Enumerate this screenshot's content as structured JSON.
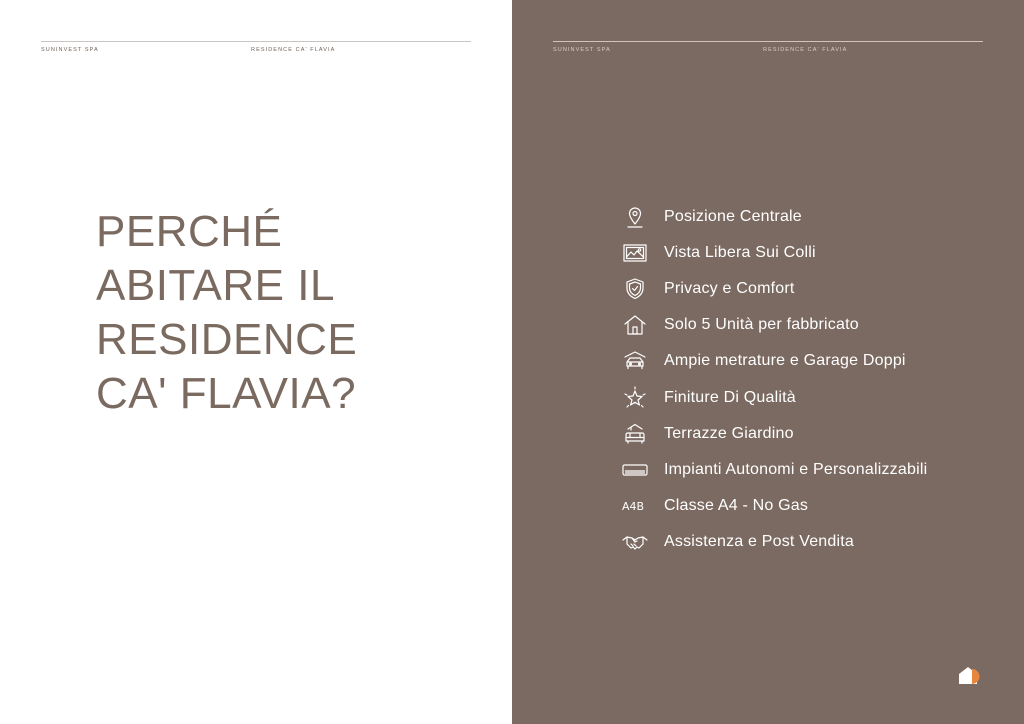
{
  "left_page": {
    "header_company": "SUNINVEST SPA",
    "header_project": "RESIDENCE CA' FLAVIA",
    "headline": [
      "PERCHÉ",
      "ABITARE IL",
      "RESIDENCE",
      "CA' FLAVIA?"
    ]
  },
  "right_page": {
    "header_company": "SUNINVEST SPA",
    "header_project": "RESIDENCE CA' FLAVIA",
    "features": [
      {
        "icon": "location-pin-icon",
        "label": "Posizione Centrale"
      },
      {
        "icon": "landscape-view-icon",
        "label": "Vista Libera Sui Colli"
      },
      {
        "icon": "shield-check-icon",
        "label": "Privacy e Comfort"
      },
      {
        "icon": "house-icon",
        "label": "Solo 5 Unità per fabbricato"
      },
      {
        "icon": "car-garage-icon",
        "label": "Ampie metrature e Garage Doppi"
      },
      {
        "icon": "sparkle-star-icon",
        "label": "Finiture Di Qualità"
      },
      {
        "icon": "terrace-sofa-icon",
        "label": "Terrazze Giardino"
      },
      {
        "icon": "air-conditioner-icon",
        "label": "Impianti Autonomi e Personalizzabili"
      },
      {
        "icon": "energy-class-icon",
        "label": "Classe A4 - No Gas",
        "icon_text": "A4B"
      },
      {
        "icon": "handshake-icon",
        "label": "Assistenza e Post Vendita"
      }
    ]
  },
  "colors": {
    "right_background": "#7b6a61",
    "headline_text": "#7a6a60",
    "logo_accent": "#e8853f"
  }
}
